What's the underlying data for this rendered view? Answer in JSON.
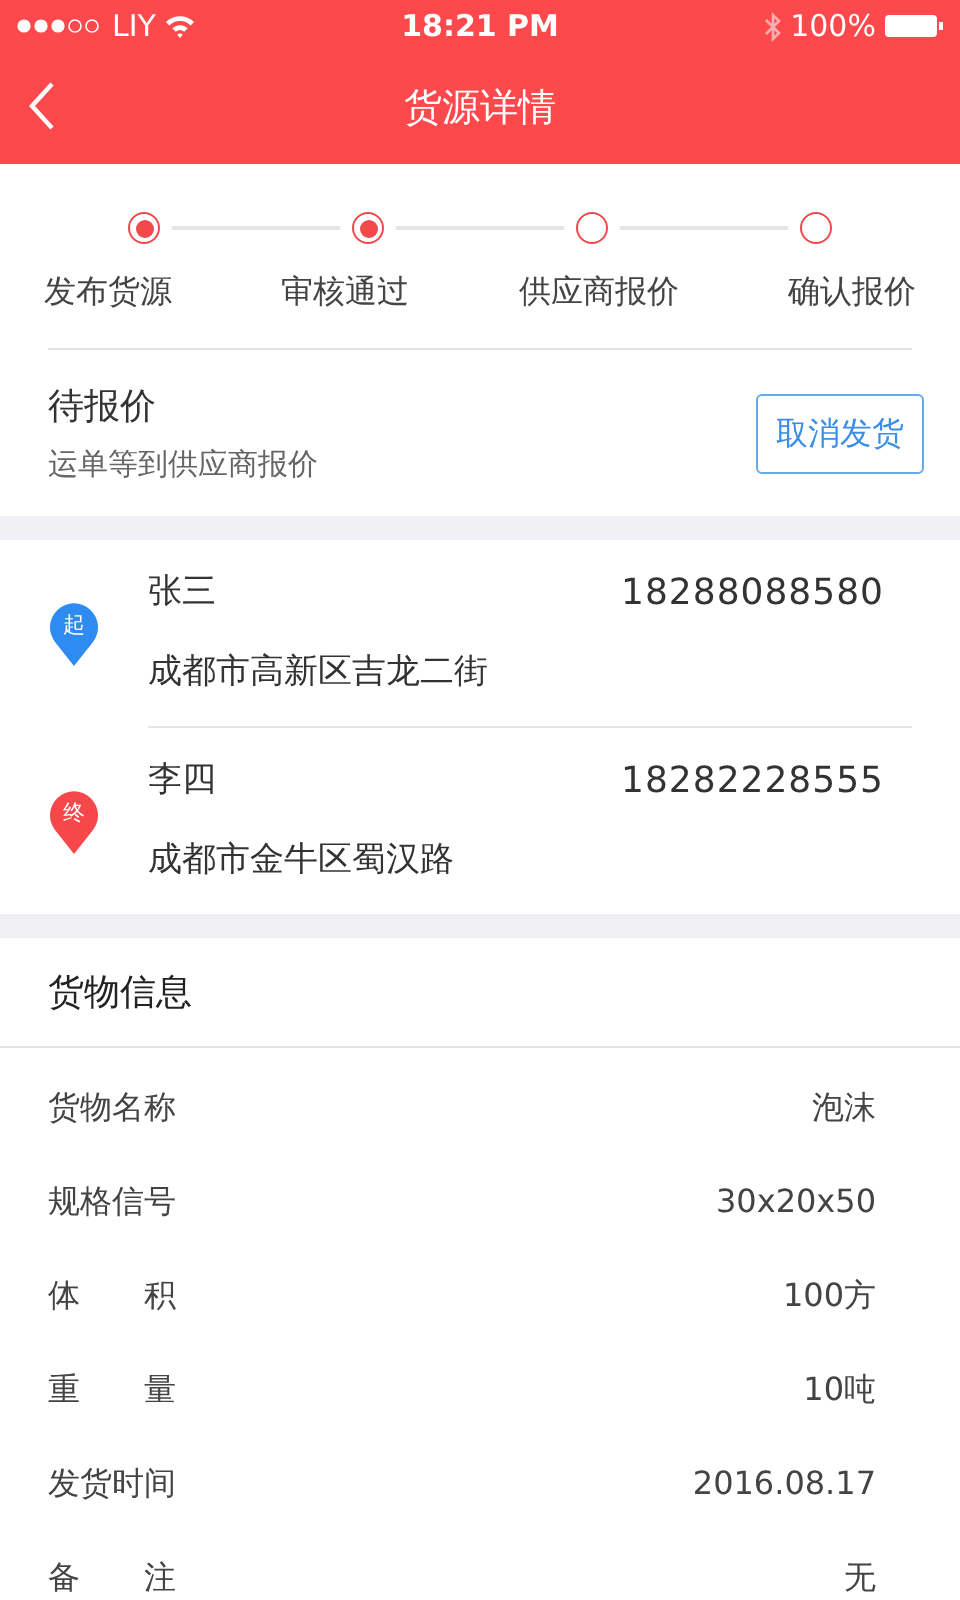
{
  "status_bar": {
    "carrier": "LIY",
    "time": "18:21 PM",
    "battery": "100%"
  },
  "nav": {
    "title": "货源详情"
  },
  "steps": [
    {
      "label": "发布货源",
      "done": true
    },
    {
      "label": "审核通过",
      "done": true
    },
    {
      "label": "供应商报价",
      "done": false
    },
    {
      "label": "确认报价",
      "done": false
    }
  ],
  "order_status": {
    "title": "待报价",
    "subtitle": "运单等到供应商报价",
    "button": "取消发货"
  },
  "addresses": [
    {
      "kind": "start",
      "pin": "起",
      "name": "张三",
      "phone": "18288088580",
      "address": "成都市高新区吉龙二街"
    },
    {
      "kind": "end",
      "pin": "终",
      "name": "李四",
      "phone": "18282228555",
      "address": "成都市金牛区蜀汉路"
    }
  ],
  "cargo": {
    "title": "货物信息",
    "rows": [
      {
        "label": "货物名称",
        "value": "泡沫"
      },
      {
        "label": "规格信号",
        "value": "30x20x50"
      },
      {
        "label": "体　　积",
        "value": "100方"
      },
      {
        "label": "重　　量",
        "value": "10吨"
      },
      {
        "label": "发货时间",
        "value": "2016.08.17"
      },
      {
        "label": "备　　注",
        "value": "无"
      }
    ]
  }
}
